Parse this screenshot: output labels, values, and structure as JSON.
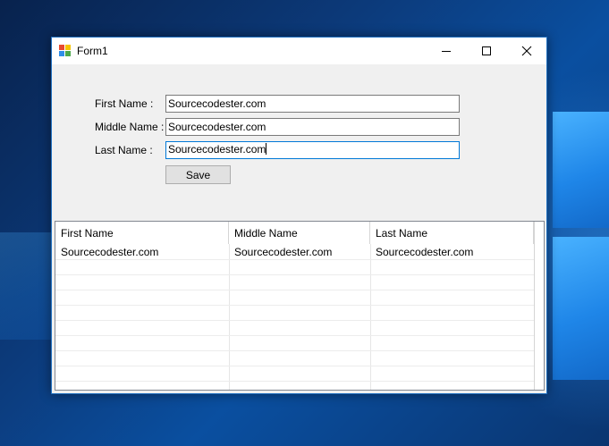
{
  "window": {
    "title": "Form1"
  },
  "form": {
    "first_label": "First Name :",
    "middle_label": "Middle Name :",
    "last_label": "Last Name :",
    "first_value": "Sourcecodester.com",
    "middle_value": "Sourcecodester.com",
    "last_value": "Sourcecodester.com",
    "save_label": "Save"
  },
  "table": {
    "columns": [
      "First Name",
      "Middle Name",
      "Last Name"
    ],
    "rows": [
      [
        "Sourcecodester.com",
        "Sourcecodester.com",
        "Sourcecodester.com"
      ]
    ]
  },
  "colors": {
    "accent": "#0078d7",
    "window_bg": "#f0f0f0",
    "desktop": "#0a3570"
  }
}
